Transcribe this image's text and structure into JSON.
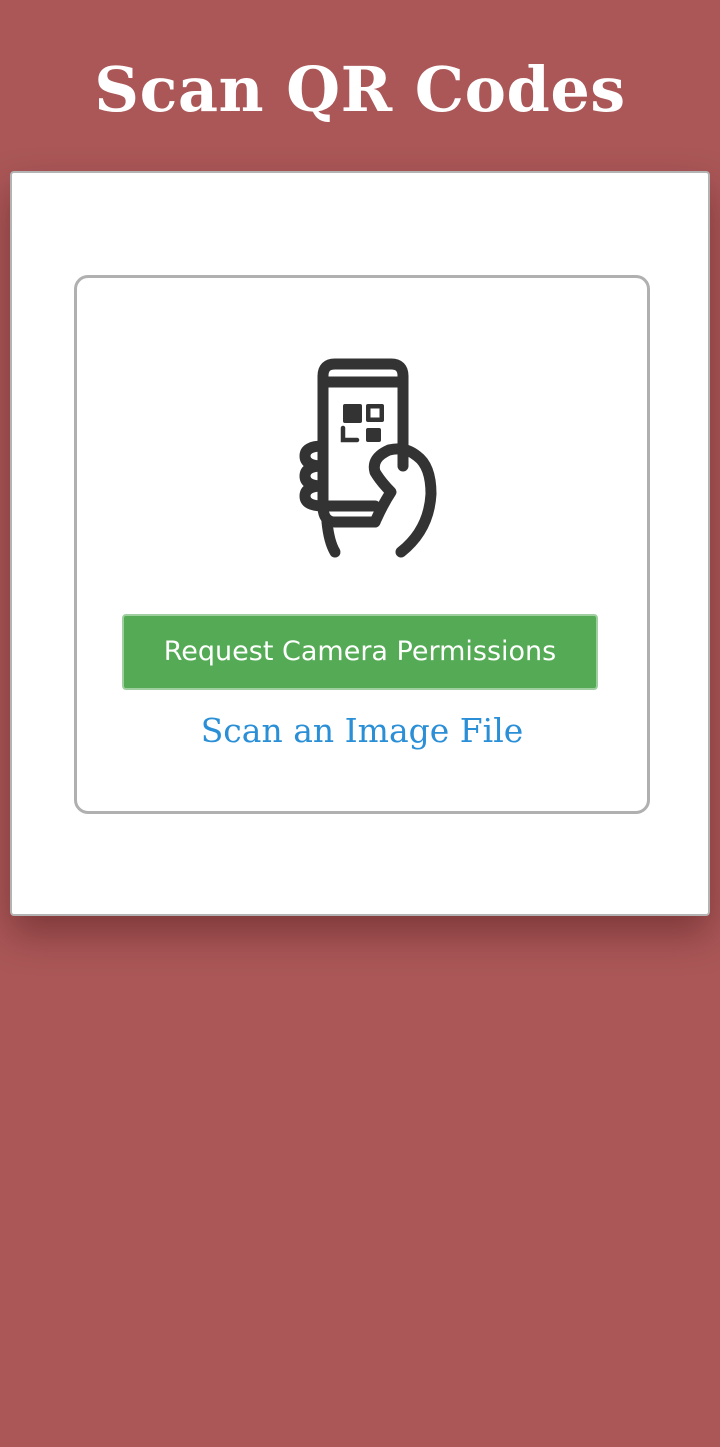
{
  "header": {
    "title": "Scan QR Codes"
  },
  "scanner": {
    "icon": "phone-qr-scan-icon",
    "request_camera_label": "Request Camera Permissions",
    "scan_image_label": "Scan an Image File"
  },
  "colors": {
    "background": "#ab5758",
    "button": "#55ab55",
    "link": "#2a8fd6",
    "icon": "#333333"
  }
}
